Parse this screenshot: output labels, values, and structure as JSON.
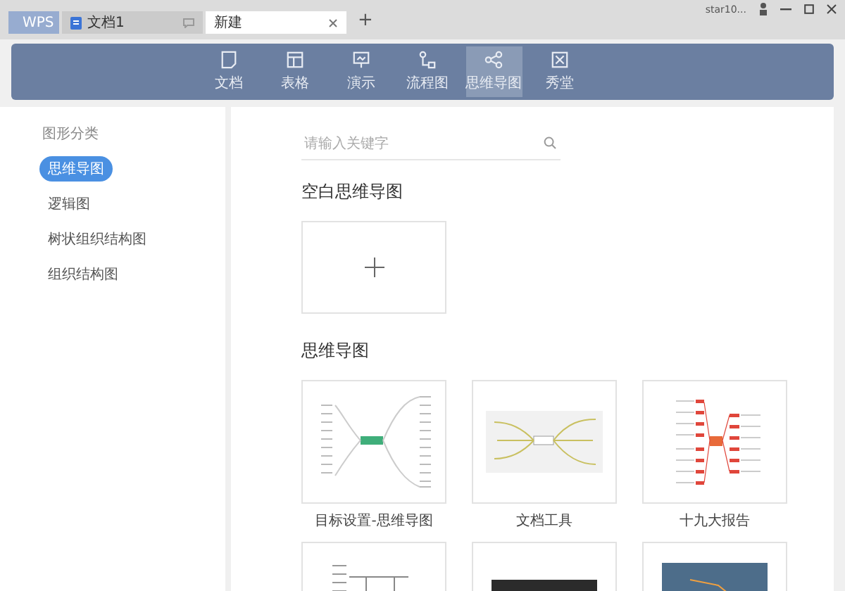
{
  "titlebar": {
    "tabs": [
      {
        "kind": "app",
        "label": "WPS",
        "selected": false
      },
      {
        "kind": "doc",
        "label": "文档1",
        "selected": false
      },
      {
        "kind": "new",
        "label": "新建",
        "selected": true
      }
    ],
    "new_tab": "+",
    "user": "star10..."
  },
  "toolbar": [
    {
      "label": "文档",
      "kind": "doc",
      "selected": false
    },
    {
      "label": "表格",
      "kind": "sheet",
      "selected": false
    },
    {
      "label": "演示",
      "kind": "slides",
      "selected": false
    },
    {
      "label": "流程图",
      "kind": "flow",
      "selected": false
    },
    {
      "label": "思维导图",
      "kind": "mindmap",
      "selected": true
    },
    {
      "label": "秀堂",
      "kind": "show",
      "selected": false
    }
  ],
  "sidebar": {
    "title": "图形分类",
    "items": [
      {
        "label": "思维导图",
        "selected": true
      },
      {
        "label": "逻辑图",
        "selected": false
      },
      {
        "label": "树状组织结构图",
        "selected": false
      },
      {
        "label": "组织结构图",
        "selected": false
      }
    ]
  },
  "search": {
    "placeholder": "请输入关键字"
  },
  "blank_section": {
    "title": "空白思维导图"
  },
  "templates_section": {
    "title": "思维导图",
    "templates": [
      {
        "kind": "green",
        "caption": "目标设置-思维导图"
      },
      {
        "kind": "yellow",
        "caption": "文档工具"
      },
      {
        "kind": "red",
        "caption": "十九大报告"
      },
      {
        "kind": "logic"
      },
      {
        "kind": "dark"
      },
      {
        "kind": "blue"
      }
    ]
  }
}
